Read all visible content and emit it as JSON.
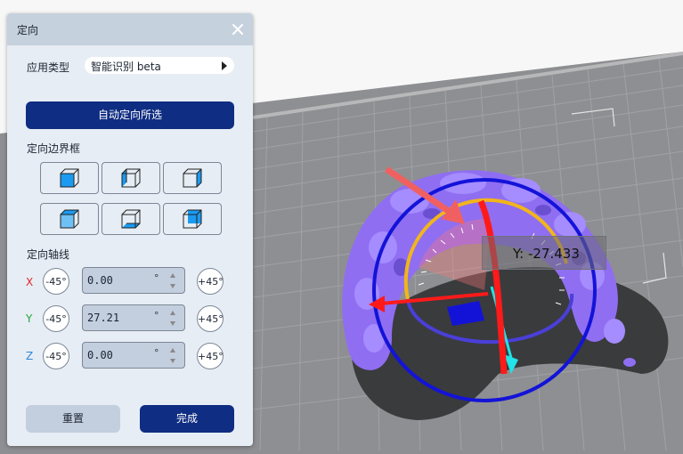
{
  "dialog": {
    "title": "定向",
    "close_icon": "close-icon",
    "app_type": {
      "label": "应用类型",
      "value": "智能识别 beta"
    },
    "auto_orient_label": "自动定向所选",
    "bbox_section_label": "定向边界框",
    "bbox_buttons": [
      "cube-face-front-icon",
      "cube-face-left-icon",
      "cube-face-right-icon",
      "cube-face-top-icon",
      "cube-face-bottom-icon",
      "cube-face-back-icon"
    ],
    "axis_section_label": "定向轴线",
    "axes": [
      {
        "name": "X",
        "color": "#e2262b",
        "minus": "-45°",
        "value": "0.00",
        "unit": "°",
        "plus": "+45°"
      },
      {
        "name": "Y",
        "color": "#1fa53b",
        "minus": "-45°",
        "value": "27.21",
        "unit": "°",
        "plus": "+45°"
      },
      {
        "name": "Z",
        "color": "#2c86d8",
        "minus": "-45°",
        "value": "0.00",
        "unit": "°",
        "plus": "+45°"
      }
    ],
    "reset_label": "重置",
    "done_label": "完成"
  },
  "viewport": {
    "rotation_readout": "Y: -27.433",
    "colors": {
      "ring_outer": "#1313d8",
      "ring_inner": "#f2b51b",
      "model": "#8f6ef2",
      "arrow": "#ff1a1a",
      "accent": "#21e3e8"
    }
  }
}
